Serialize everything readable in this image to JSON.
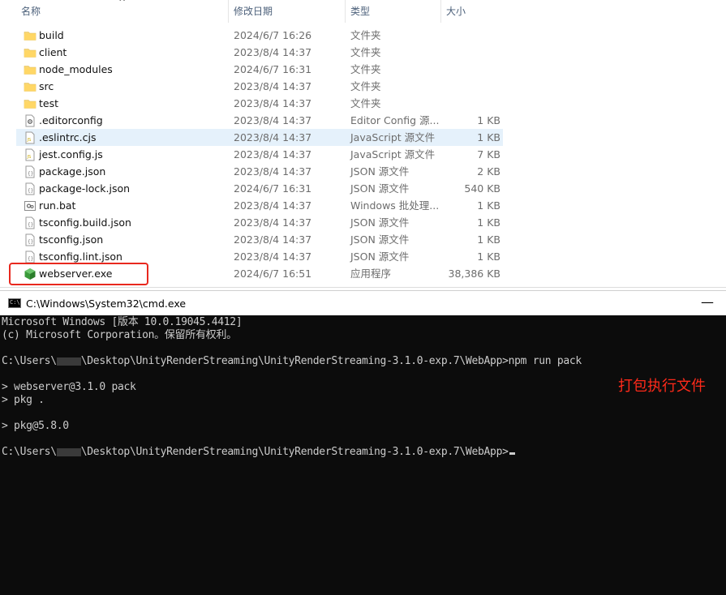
{
  "explorer": {
    "columns": {
      "name": "名称",
      "date": "修改日期",
      "type": "类型",
      "size": "大小"
    },
    "files": [
      {
        "name": "build",
        "date": "2024/6/7 16:26",
        "type": "文件夹",
        "size": "",
        "icon": "folder-icon"
      },
      {
        "name": "client",
        "date": "2023/8/4 14:37",
        "type": "文件夹",
        "size": "",
        "icon": "folder-icon"
      },
      {
        "name": "node_modules",
        "date": "2024/6/7 16:31",
        "type": "文件夹",
        "size": "",
        "icon": "folder-icon"
      },
      {
        "name": "src",
        "date": "2023/8/4 14:37",
        "type": "文件夹",
        "size": "",
        "icon": "folder-icon"
      },
      {
        "name": "test",
        "date": "2023/8/4 14:37",
        "type": "文件夹",
        "size": "",
        "icon": "folder-icon"
      },
      {
        "name": ".editorconfig",
        "date": "2023/8/4 14:37",
        "type": "Editor Config 源...",
        "size": "1 KB",
        "icon": "config-file-icon"
      },
      {
        "name": ".eslintrc.cjs",
        "date": "2023/8/4 14:37",
        "type": "JavaScript 源文件",
        "size": "1 KB",
        "icon": "js-file-icon"
      },
      {
        "name": "jest.config.js",
        "date": "2023/8/4 14:37",
        "type": "JavaScript 源文件",
        "size": "7 KB",
        "icon": "js-file-icon"
      },
      {
        "name": "package.json",
        "date": "2023/8/4 14:37",
        "type": "JSON 源文件",
        "size": "2 KB",
        "icon": "json-file-icon"
      },
      {
        "name": "package-lock.json",
        "date": "2024/6/7 16:31",
        "type": "JSON 源文件",
        "size": "540 KB",
        "icon": "json-file-icon"
      },
      {
        "name": "run.bat",
        "date": "2023/8/4 14:37",
        "type": "Windows 批处理...",
        "size": "1 KB",
        "icon": "batch-file-icon"
      },
      {
        "name": "tsconfig.build.json",
        "date": "2023/8/4 14:37",
        "type": "JSON 源文件",
        "size": "1 KB",
        "icon": "json-file-icon"
      },
      {
        "name": "tsconfig.json",
        "date": "2023/8/4 14:37",
        "type": "JSON 源文件",
        "size": "1 KB",
        "icon": "json-file-icon"
      },
      {
        "name": "tsconfig.lint.json",
        "date": "2023/8/4 14:37",
        "type": "JSON 源文件",
        "size": "1 KB",
        "icon": "json-file-icon"
      },
      {
        "name": "webserver.exe",
        "date": "2024/6/7 16:51",
        "type": "应用程序",
        "size": "38,386 KB",
        "icon": "exe-cube-icon"
      }
    ]
  },
  "cmd": {
    "title": "C:\\Windows\\System32\\cmd.exe",
    "minimize": "—",
    "lines": {
      "l1": "Microsoft Windows [版本 10.0.19045.4412]",
      "l2": "(c) Microsoft Corporation。保留所有权利。",
      "p1_pre": "C:\\Users\\",
      "p1_post": "\\Desktop\\UnityRenderStreaming\\UnityRenderStreaming-3.1.0-exp.7\\WebApp>npm run pack",
      "l4": "> webserver@3.1.0 pack",
      "l5": "> pkg .",
      "l6": "> pkg@5.8.0",
      "p2_pre": "C:\\Users\\",
      "p2_post": "\\Desktop\\UnityRenderStreaming\\UnityRenderStreaming-3.1.0-exp.7\\WebApp>"
    },
    "annotation": "打包执行文件"
  },
  "colors": {
    "highlight": "#e8281e",
    "annotation": "#ff2a1a",
    "console_bg": "#0c0c0c",
    "selected_row": "#e5f1fb"
  }
}
